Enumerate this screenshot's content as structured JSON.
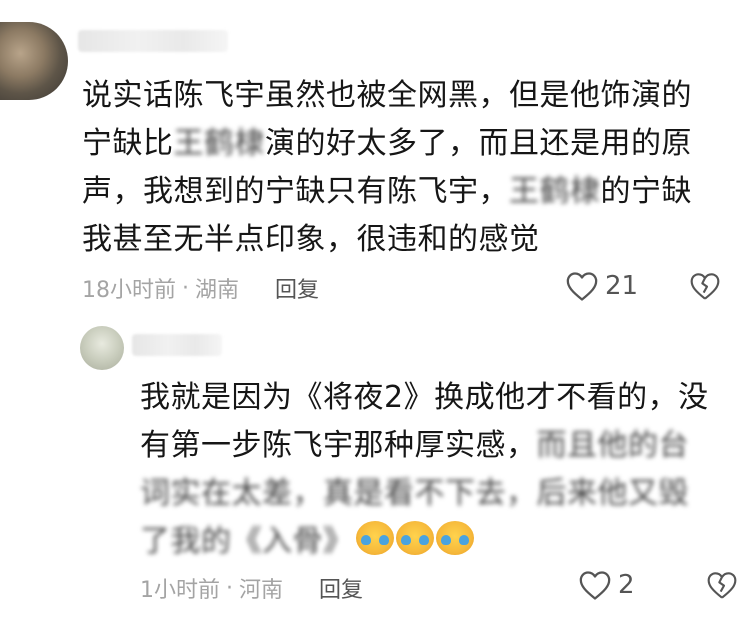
{
  "comments": [
    {
      "lines": [
        "说实话陈飞宇虽然也被全网黑，但是他饰演的",
        "宁缺比",
        "演的好太多了，而且还是用的原",
        "声，我想到的宁缺只有陈飞宇，",
        "的宁缺",
        "我甚至无半点印象，很违和的感觉"
      ],
      "blurred": [
        "王鹤棣",
        "王鹤棣"
      ],
      "time": "18小时前",
      "location": "湖南",
      "reply_label": "回复",
      "likes": "21"
    },
    {
      "lines": [
        "我就是因为《将夜2》换成他才不看的，没",
        "有第一步陈飞宇那种厚实感，",
        "而且他的台",
        "词实在太差，真是看不下去，后来他又毁",
        "了我的《入骨》"
      ],
      "time": "1小时前",
      "location": "河南",
      "reply_label": "回复",
      "likes": "2"
    }
  ],
  "separator": "·"
}
